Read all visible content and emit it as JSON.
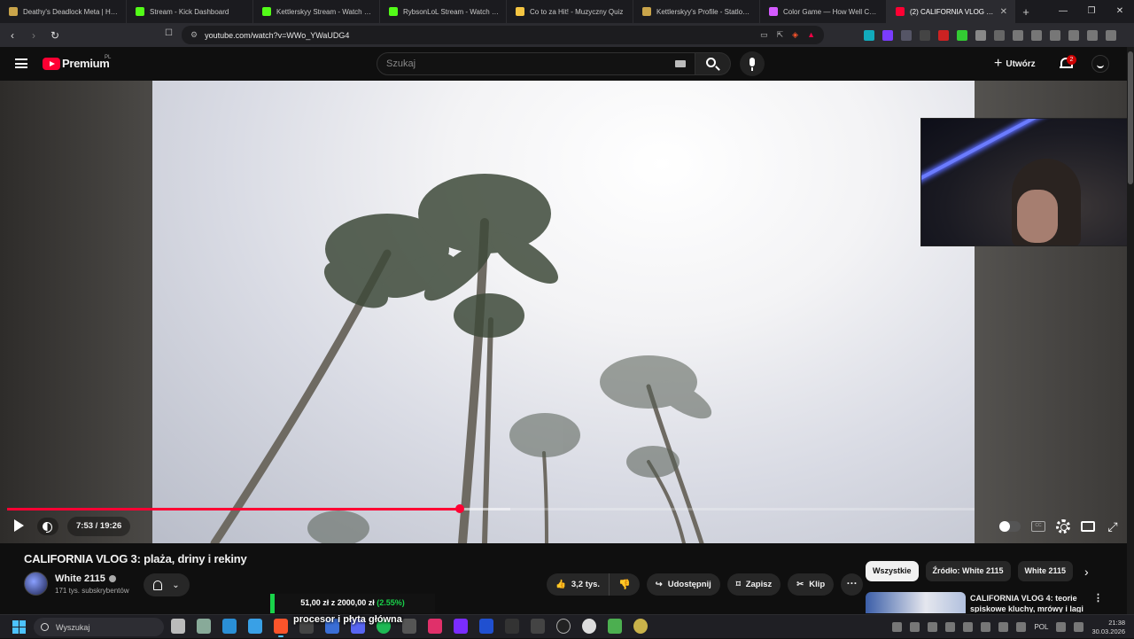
{
  "browser": {
    "tabs": [
      {
        "title": "Deathy's Deadlock Meta | Hero",
        "favicon": "deadlock-icon",
        "color": "#c9a44a"
      },
      {
        "title": "Stream - Kick Dashboard",
        "favicon": "kick-icon",
        "color": "#53fc18"
      },
      {
        "title": "Kettlerskyy Stream - Watch Live",
        "favicon": "kick-icon",
        "color": "#53fc18"
      },
      {
        "title": "RybsonLoL Stream - Watch Live",
        "favicon": "kick-icon",
        "color": "#53fc18"
      },
      {
        "title": "Co to za Hit! - Muzyczny Quiz",
        "favicon": "music-icon",
        "color": "#f5c542"
      },
      {
        "title": "Kettlerskyy's Profile - Statlocker",
        "favicon": "statlocker-icon",
        "color": "#c9a44a"
      },
      {
        "title": "Color Game — How Well Can You",
        "favicon": "color-icon",
        "color": "#d45bff"
      },
      {
        "title": "(2) CALIFORNIA VLOG 3: p",
        "favicon": "youtube-icon",
        "color": "#ff0033"
      }
    ],
    "new_tab": "+",
    "url": "youtube.com/watch?v=WWo_YWaUDG4"
  },
  "youtube": {
    "brand": "Premium",
    "region": "PL",
    "search_placeholder": "Szukaj",
    "create_label": "Utwórz",
    "notification_count": "2"
  },
  "player": {
    "time": "7:53 / 19:26",
    "progress": 0.468,
    "buffered": 0.52
  },
  "video": {
    "title": "CALIFORNIA VLOG 3: plaża, driny i rekiny",
    "channel": "White 2115",
    "subscribers": "171 tys. subskrybentów",
    "likes": "3,2 tys.",
    "share": "Udostępnij",
    "save": "Zapisz",
    "clip": "Klip"
  },
  "recommendations": {
    "chips": [
      "Wszystkie",
      "Źródło: White 2115",
      "White 2115"
    ],
    "first_title": "CALIFORNIA VLOG 4: teorie spiskowe kluchy, mrówy i lagi"
  },
  "donation": {
    "amount": "51,00 zł z 2000,00 zł",
    "percent": "(2.55%)",
    "progress": 0.0255
  },
  "subtitle_text": "procesor i płyta główna",
  "taskbar": {
    "search_placeholder": "Wyszukaj",
    "language": "POL",
    "time": "21:38",
    "date": "30.03.2026"
  }
}
